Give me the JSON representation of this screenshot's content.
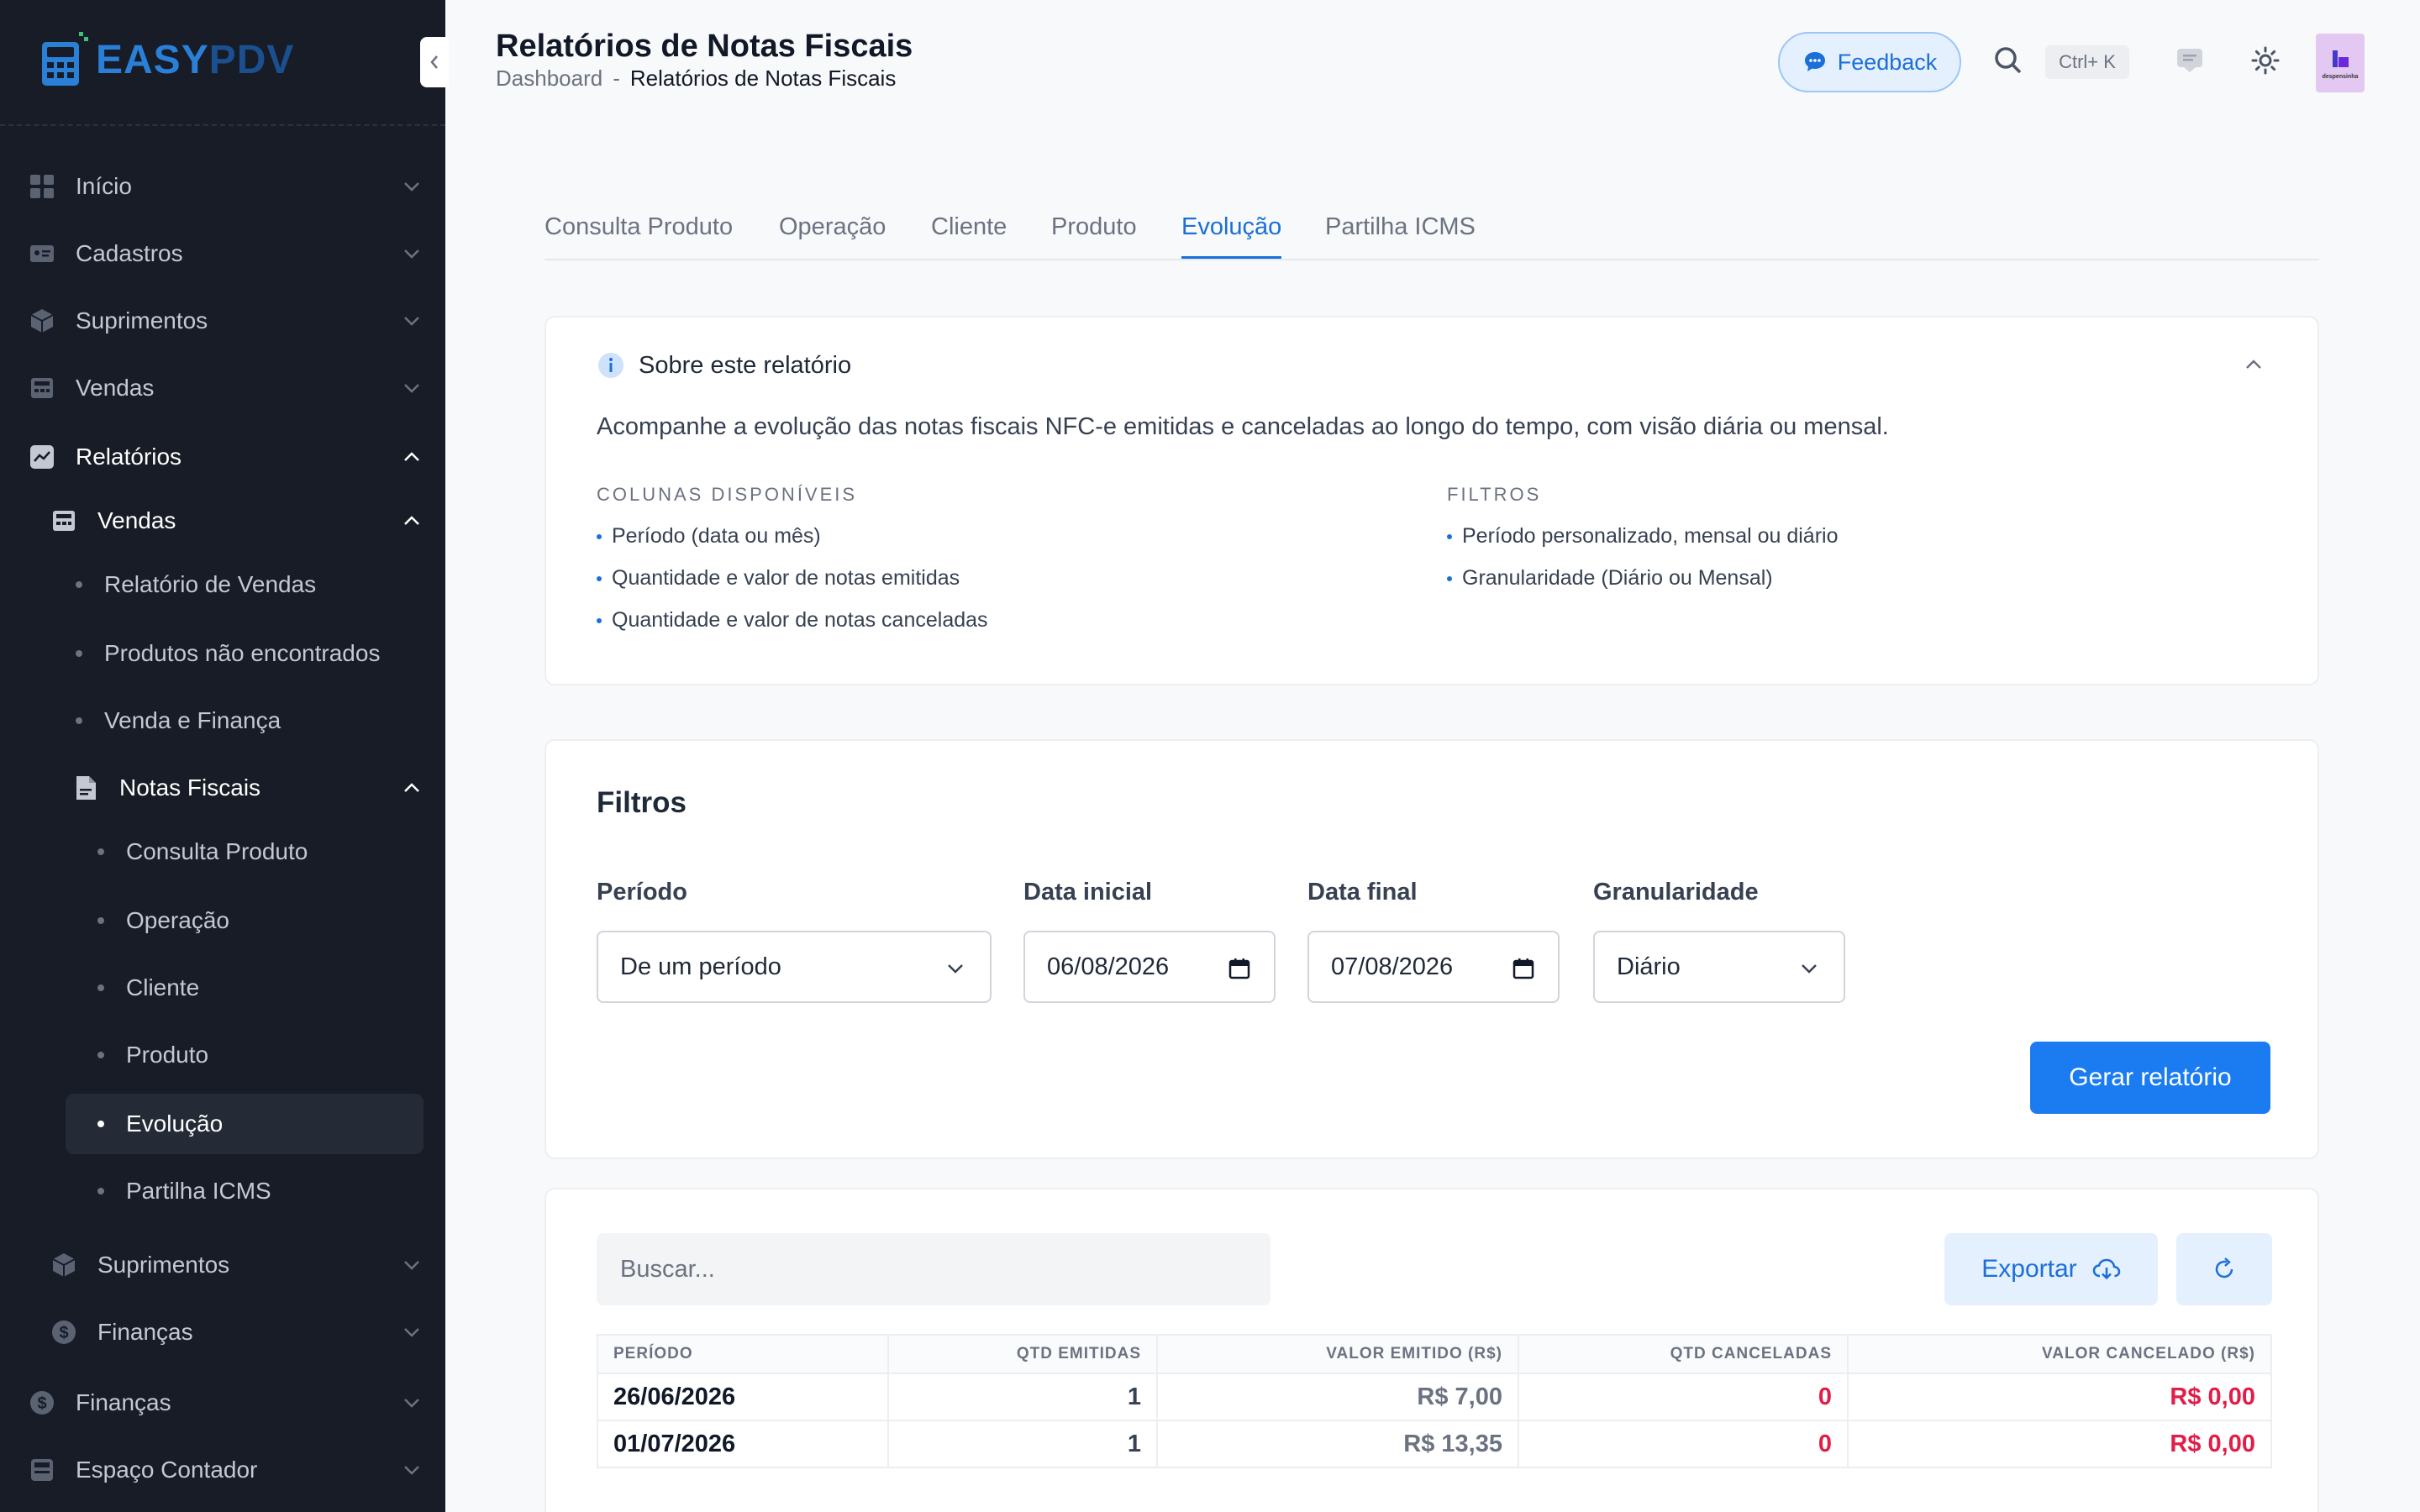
{
  "app": {
    "logo_easy": "EASY",
    "logo_pdv": "PDV"
  },
  "sidebar": {
    "items": [
      {
        "label": "Início",
        "icon": "grid-icon"
      },
      {
        "label": "Cadastros",
        "icon": "id-card-icon"
      },
      {
        "label": "Suprimentos",
        "icon": "box-icon"
      },
      {
        "label": "Vendas",
        "icon": "register-icon"
      },
      {
        "label": "Relatórios",
        "icon": "chart-icon"
      }
    ],
    "vendas_group": "Vendas",
    "vendas_children": [
      "Relatório de Vendas",
      "Produtos não encontrados",
      "Venda e Finança"
    ],
    "notas_group": "Notas Fiscais",
    "notas_children": [
      "Consulta Produto",
      "Operação",
      "Cliente",
      "Produto",
      "Evolução",
      "Partilha ICMS"
    ],
    "sub_suprimentos": "Suprimentos",
    "sub_financas": "Finanças",
    "financas": "Finanças",
    "espaco_contador": "Espaço Contador",
    "active_child": "Evolução"
  },
  "header": {
    "title": "Relatórios de Notas Fiscais",
    "breadcrumb": {
      "home": "Dashboard",
      "separator": "-",
      "current": "Relatórios de Notas Fiscais"
    },
    "feedback_label": "Feedback",
    "shortcut": "Ctrl+ K",
    "avatar_text": "despensinha"
  },
  "tabs": [
    "Consulta Produto",
    "Operação",
    "Cliente",
    "Produto",
    "Evolução",
    "Partilha ICMS"
  ],
  "active_tab": "Evolução",
  "about": {
    "title": "Sobre este relatório",
    "description": "Acompanhe a evolução das notas fiscais NFC-e emitidas e canceladas ao longo do tempo, com visão diária ou mensal.",
    "columns_title": "COLUNAS DISPONÍVEIS",
    "columns": [
      "Período (data ou mês)",
      "Quantidade e valor de notas emitidas",
      "Quantidade e valor de notas canceladas"
    ],
    "filters_title": "FILTROS",
    "filters": [
      "Período personalizado, mensal ou diário",
      "Granularidade (Diário ou Mensal)"
    ]
  },
  "filters": {
    "title": "Filtros",
    "periodo_label": "Período",
    "periodo_value": "De um período",
    "data_inicial_label": "Data inicial",
    "data_inicial_value": "06/08/2026",
    "data_final_label": "Data final",
    "data_final_value": "07/08/2026",
    "granularidade_label": "Granularidade",
    "granularidade_value": "Diário",
    "generate_label": "Gerar relatório"
  },
  "table": {
    "search_placeholder": "Buscar...",
    "export_label": "Exportar",
    "headers": [
      "PERÍODO",
      "QTD EMITIDAS",
      "VALOR EMITIDO (R$)",
      "QTD CANCELADAS",
      "VALOR CANCELADO (R$)"
    ],
    "rows": [
      {
        "periodo": "26/06/2026",
        "qtd_emitidas": "1",
        "valor_emitido": "R$ 7,00",
        "qtd_canceladas": "0",
        "valor_cancelado": "R$ 0,00"
      },
      {
        "periodo": "01/07/2026",
        "qtd_emitidas": "1",
        "valor_emitido": "R$ 13,35",
        "qtd_canceladas": "0",
        "valor_cancelado": "R$ 0,00"
      }
    ]
  },
  "colors": {
    "accent": "#1b7cf2",
    "sidebar_bg": "#171c26",
    "danger": "#e11d48"
  }
}
